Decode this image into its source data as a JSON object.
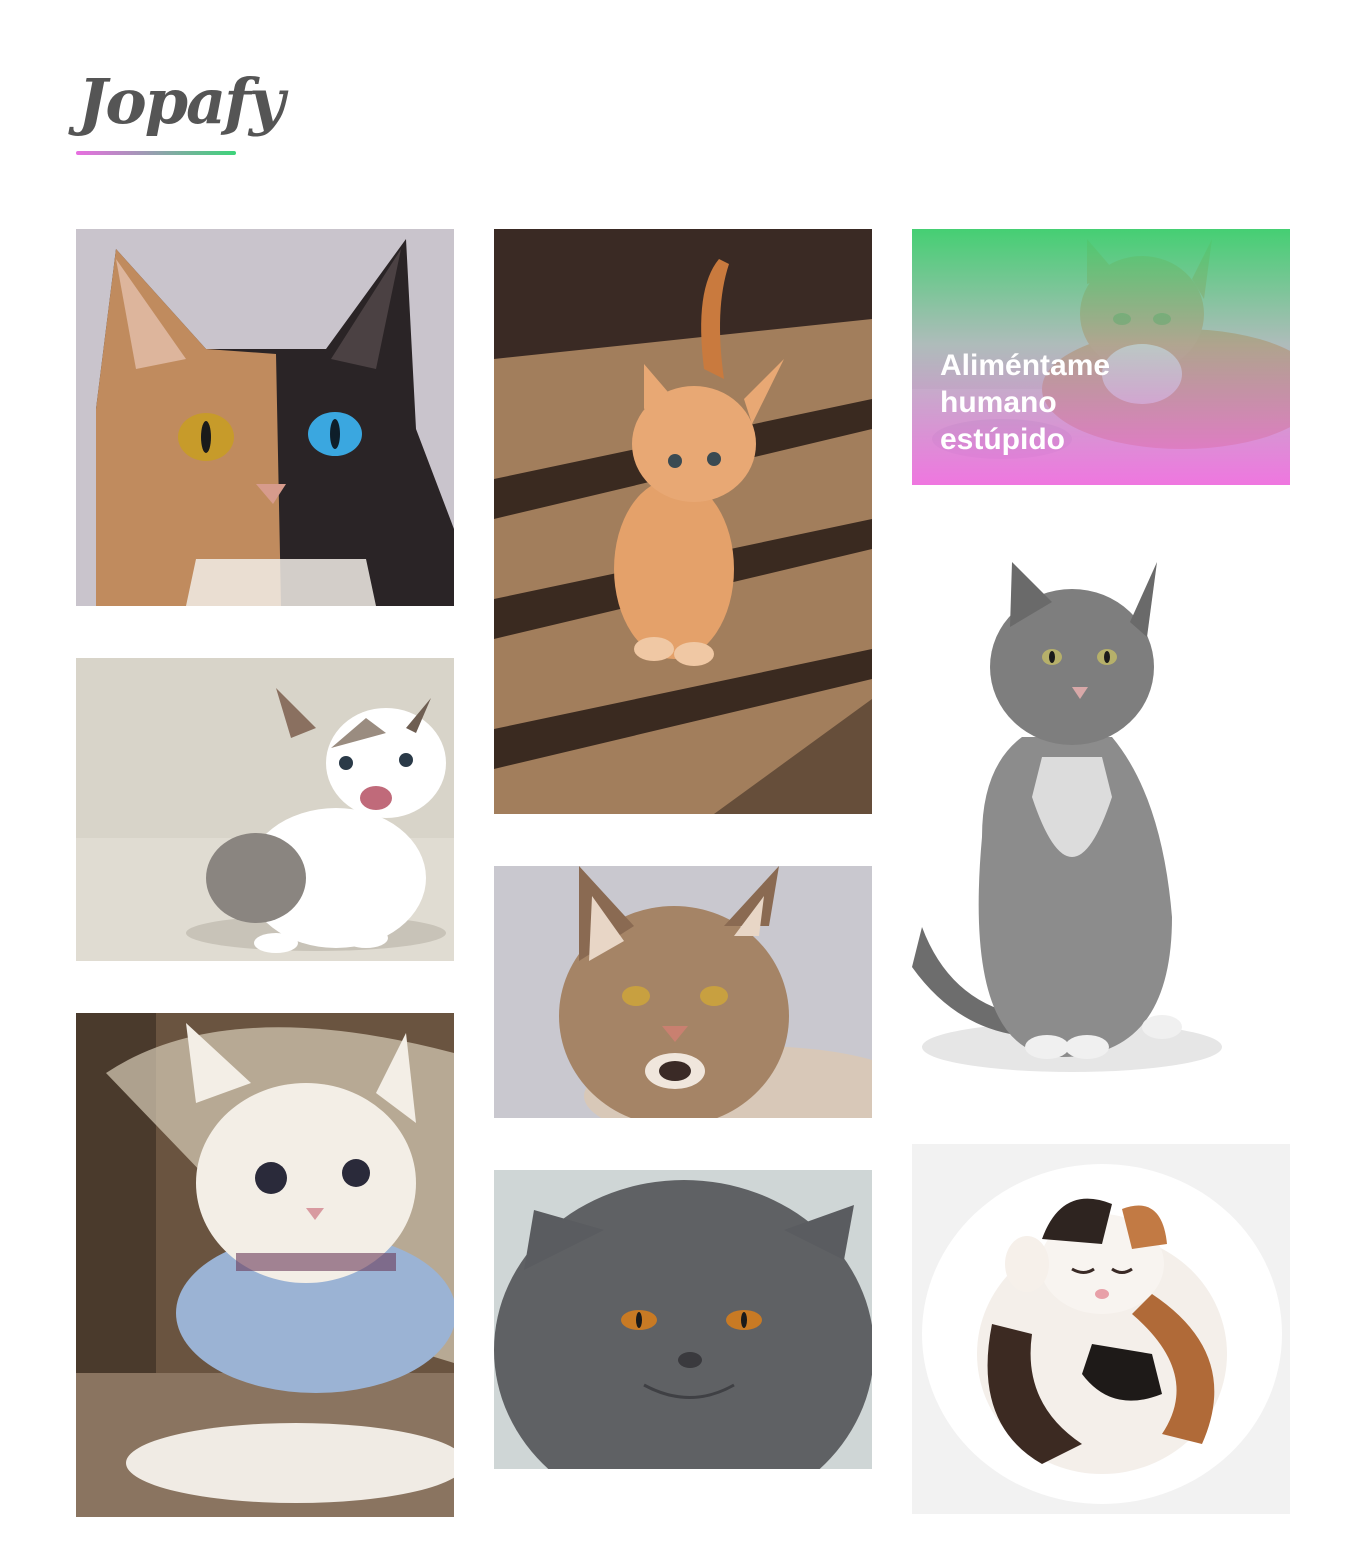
{
  "logo": {
    "text": "Jopafy",
    "gradient_from": "#e86ee0",
    "gradient_to": "#3dd47a"
  },
  "gallery": [
    {
      "id": "cat-two-tone",
      "alt_icon": "two-tone-cat-photo"
    },
    {
      "id": "cat-kitten-meowing",
      "alt_icon": "calico-kitten-photo"
    },
    {
      "id": "cat-white-sweater",
      "alt_icon": "white-kitten-photo"
    },
    {
      "id": "cat-orange-kitten",
      "alt_icon": "orange-kitten-photo"
    },
    {
      "id": "cat-maine-coon",
      "alt_icon": "maine-coon-photo"
    },
    {
      "id": "cat-grey-british",
      "alt_icon": "grey-cat-photo"
    },
    {
      "id": "cat-featured",
      "caption": "Aliméntame humano estúpido",
      "overlay_from": "#3dcf6e",
      "overlay_to": "#f06be0"
    },
    {
      "id": "cat-drawn-tabby",
      "alt_icon": "drawn-tabby-cat"
    },
    {
      "id": "cat-sleeping-calico",
      "alt_icon": "sleeping-calico-photo"
    }
  ]
}
